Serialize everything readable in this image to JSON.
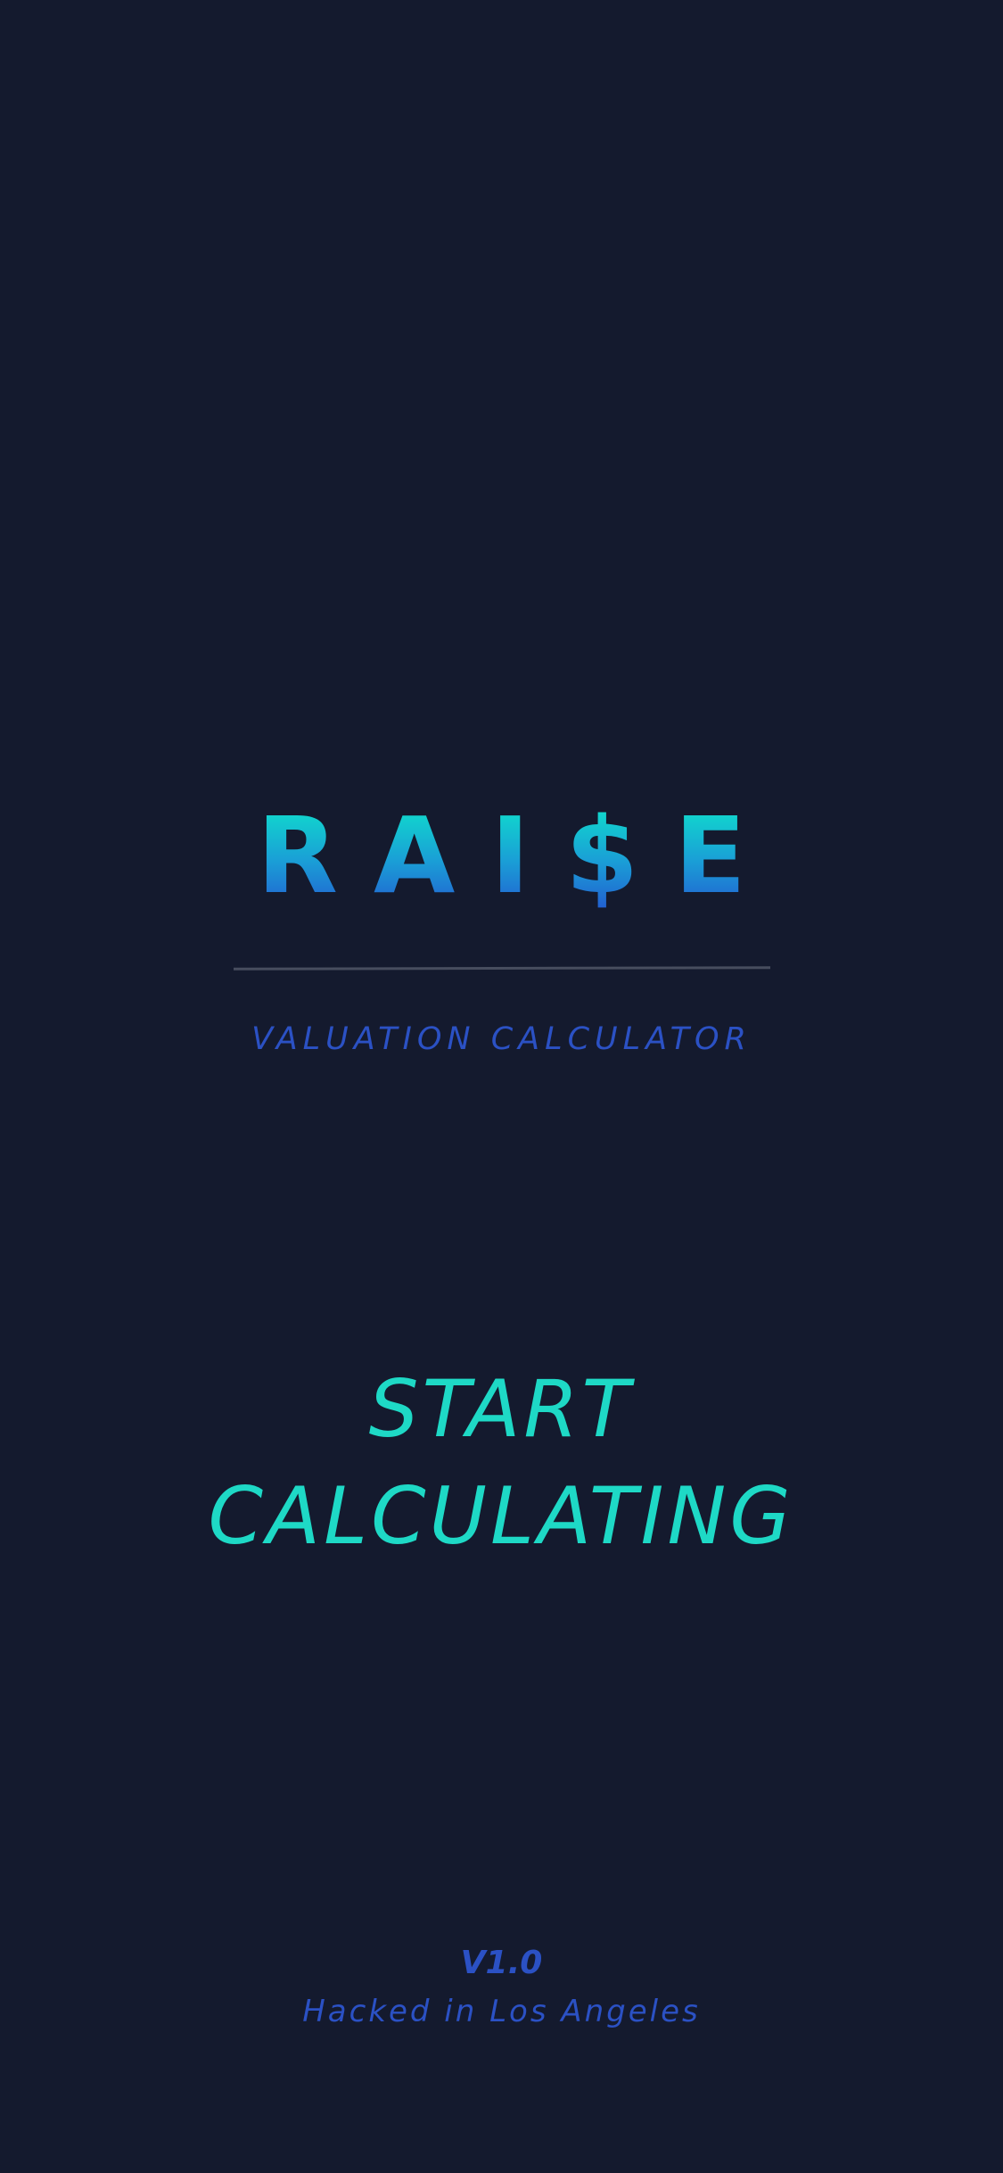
{
  "app": {
    "logo_text": "RAI$E",
    "subtitle": "VALUATION CALCULATOR"
  },
  "cta": {
    "line1": "START",
    "line2": "CALCULATING"
  },
  "footer": {
    "version": "V1.0",
    "tagline": "Hacked in Los Angeles"
  },
  "colors": {
    "background": "#141a2e",
    "accent_teal": "#1ed9c6",
    "accent_blue": "#2b51c4",
    "divider": "#474d5e"
  }
}
